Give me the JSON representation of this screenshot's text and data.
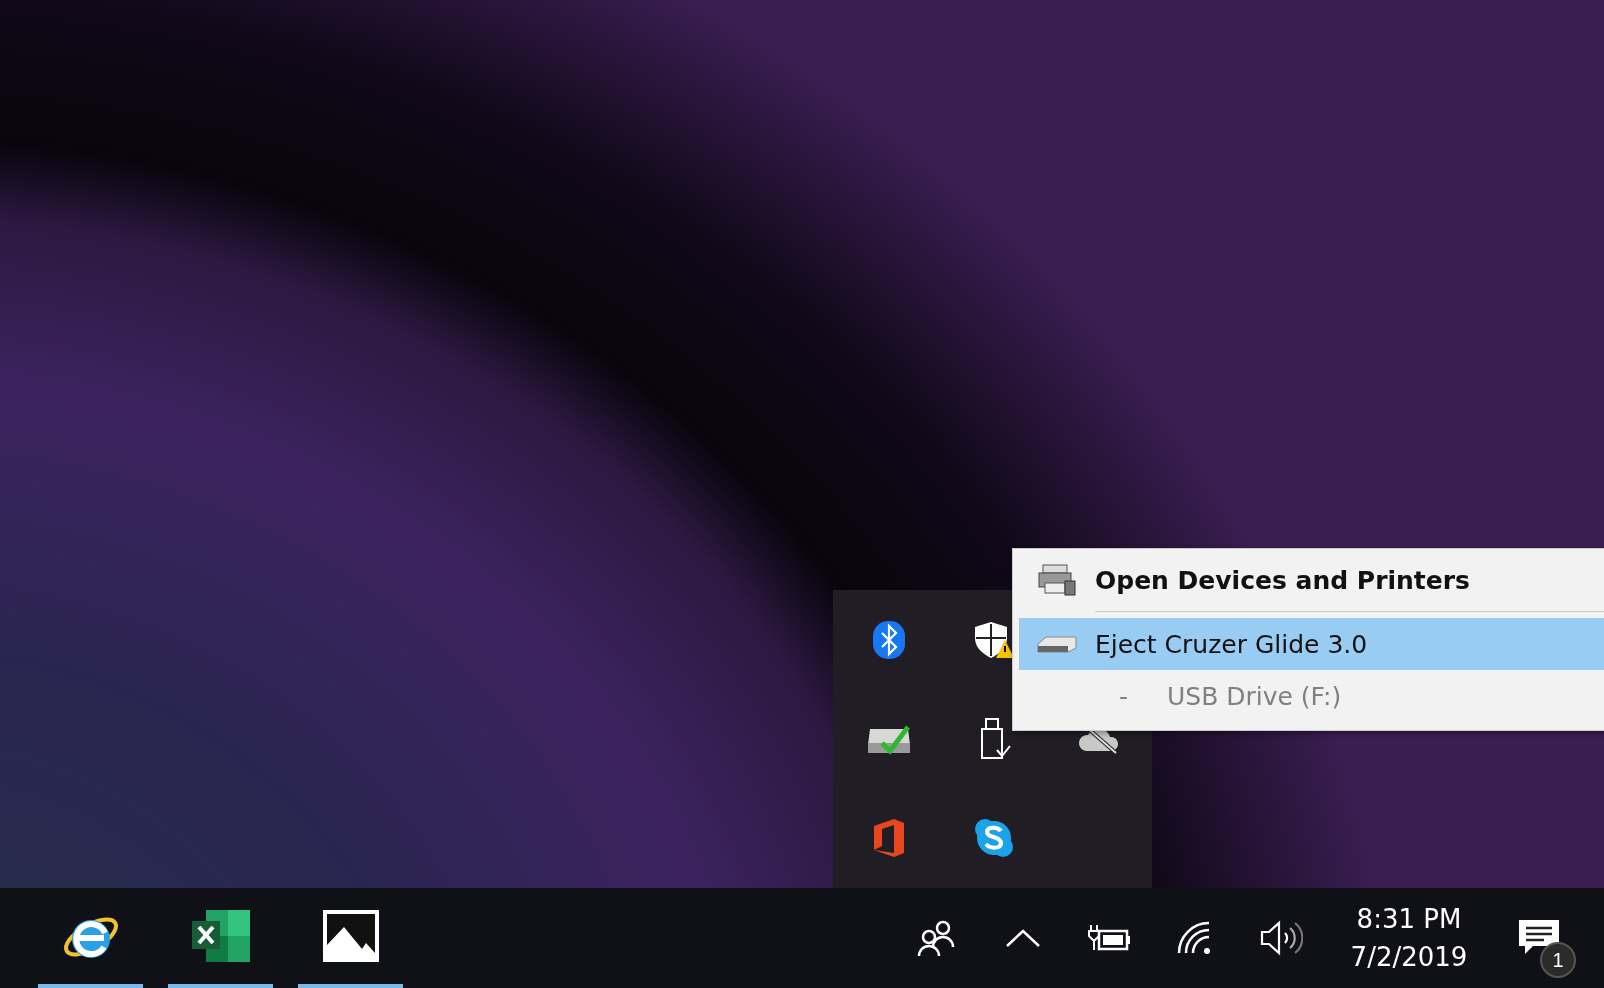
{
  "tray_overflow": {
    "rows": [
      [
        {
          "kind": "bluetooth"
        },
        {
          "kind": "shield-warning"
        }
      ],
      [
        {
          "kind": "drive-check"
        },
        {
          "kind": "usb"
        },
        {
          "kind": "cloud-off"
        }
      ],
      [
        {
          "kind": "office"
        },
        {
          "kind": "skype"
        }
      ]
    ]
  },
  "context_menu": {
    "items": [
      {
        "kind": "header",
        "label": "Open Devices and Printers",
        "selected": false
      },
      {
        "kind": "device",
        "label": "Eject Cruzer Glide 3.0",
        "selected": true
      },
      {
        "kind": "volume",
        "prefix": "-",
        "label": "USB Drive (F:)",
        "selected": false
      }
    ]
  },
  "taskbar": {
    "apps": [
      {
        "kind": "ie",
        "running": true
      },
      {
        "kind": "excel",
        "running": true
      },
      {
        "kind": "photos",
        "running": true
      }
    ],
    "tray": [
      {
        "kind": "people"
      },
      {
        "kind": "chevron"
      },
      {
        "kind": "battery"
      },
      {
        "kind": "wifi"
      },
      {
        "kind": "volume"
      }
    ],
    "clock": {
      "time": "8:31 PM",
      "date": "7/2/2019"
    },
    "notifications": {
      "count": "1"
    }
  }
}
